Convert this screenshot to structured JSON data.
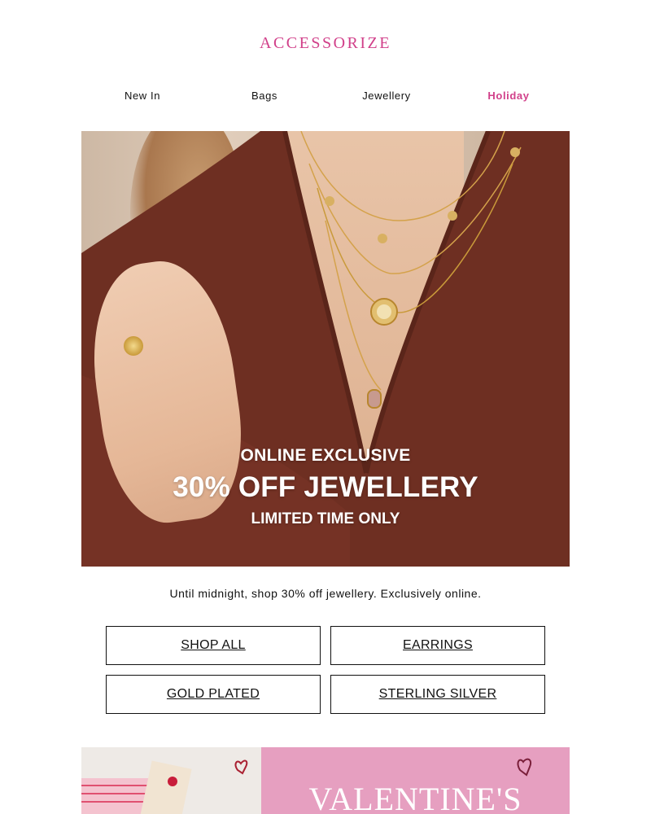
{
  "brand": {
    "logo": "ACCESSORIZE",
    "accent": "#d1408a"
  },
  "nav": {
    "items": [
      {
        "label": "New In"
      },
      {
        "label": "Bags"
      },
      {
        "label": "Jewellery"
      },
      {
        "label": "Holiday"
      }
    ]
  },
  "hero": {
    "kicker": "ONLINE EXCLUSIVE",
    "title": "30% OFF JEWELLERY",
    "sub": "LIMITED TIME ONLY"
  },
  "tagline": "Until midnight, shop 30% off jewellery. Exclusively online.",
  "buttons": [
    {
      "label": "SHOP ALL"
    },
    {
      "label": "EARRINGS"
    },
    {
      "label": "GOLD PLATED"
    },
    {
      "label": "STERLING SILVER"
    }
  ],
  "promo": {
    "title": "VALENTINE'S",
    "bg": "#e69fc0"
  }
}
